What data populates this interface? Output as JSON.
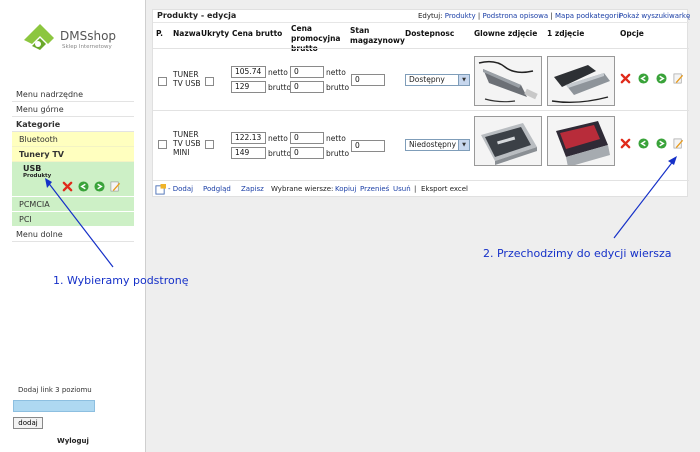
{
  "logo": {
    "brand": "DMSshop",
    "tagline": "Sklep Internetowy"
  },
  "sidebar": {
    "menu_top": "Menu nadrzędne",
    "menu_upper": "Menu górne",
    "categories": "Kategorie",
    "bluetooth": "Bluetooth",
    "tunery": "Tunery TV",
    "usb": "USB",
    "usb_sub": "Produkty",
    "pcmcia": "PCMCIA",
    "pci": "PCI",
    "menu_bottom": "Menu dolne",
    "add_link_label": "Dodaj link 3 poziomu",
    "add_button": "dodaj",
    "logout": "Wyloguj"
  },
  "panel": {
    "title": "Produkty - edycja",
    "edit_prefix": "Edytuj:",
    "edit_links": [
      "Produkty",
      "Podstrona opisowa",
      "Mapa podkategorii"
    ],
    "separator": "|",
    "show_search": "Pokaż wyszukiwarkę",
    "headers": {
      "p": "P.",
      "name": "Nazwa",
      "hidden": "Ukryty",
      "gross": "Cena brutto",
      "promo_1": "Cena",
      "promo_2": "promocyjna",
      "promo_3": "brutto",
      "stock_1": "Stan",
      "stock_2": "magazynowy",
      "avail": "Dostepnosc",
      "main_img": "Glowne zdjęcie",
      "img1": "1 zdjęcie",
      "options": "Opcje"
    },
    "netto": "netto",
    "brutto": "brutto",
    "rows": [
      {
        "name_1": "TUNER",
        "name_2": "TV USB",
        "name_3": "",
        "net": "105.74",
        "gross": "129",
        "promo_net": "0",
        "promo_gross": "0",
        "stock": "0",
        "availability": "Dostępny"
      },
      {
        "name_1": "TUNER",
        "name_2": "TV USB",
        "name_3": "MINI",
        "net": "122.13",
        "gross": "149",
        "promo_net": "0",
        "promo_gross": "0",
        "stock": "0",
        "availability": "Niedostępny"
      }
    ],
    "footer": {
      "add": "- Dodaj",
      "preview": "Podgląd",
      "save": "Zapisz",
      "selected": "Wybrane wiersze:",
      "copy": "Kopiuj",
      "move": "Przenieś",
      "delete": "Usuń",
      "sep": "|",
      "export": "Eksport excel"
    }
  },
  "annotations": {
    "step1": "1. Wybieramy podstronę",
    "step2": "2. Przechodzimy do edycji wiersza"
  },
  "colors": {
    "link": "#1b3fa6",
    "annotation": "#1530c8",
    "yellow_item": "#ffffbf",
    "green_item": "#cdf0c6"
  }
}
